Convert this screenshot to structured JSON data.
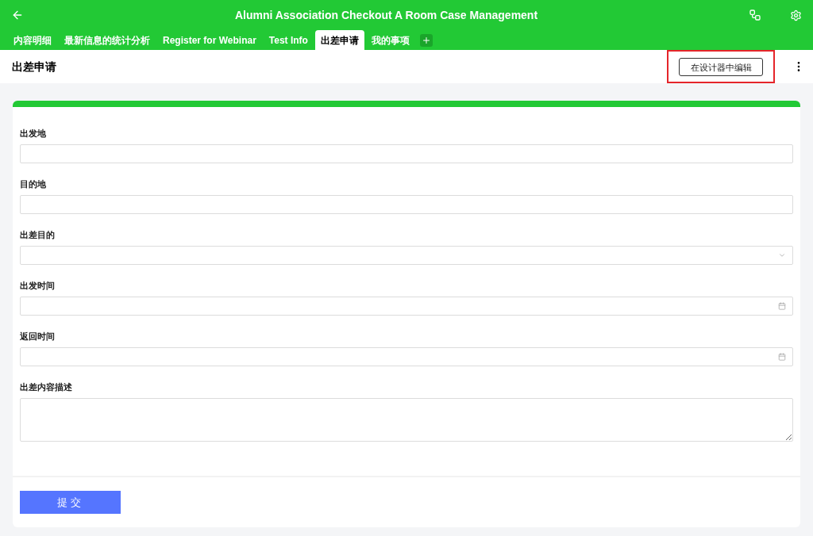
{
  "app_bar": {
    "title": "Alumni Association Checkout A Room Case Management"
  },
  "tabs": [
    {
      "label": "内容明细",
      "selected": false
    },
    {
      "label": "最新信息的统计分析",
      "selected": false
    },
    {
      "label": "Register for Webinar",
      "selected": false
    },
    {
      "label": "Test Info",
      "selected": false
    },
    {
      "label": "出差申请",
      "selected": true
    },
    {
      "label": "我的事项",
      "selected": false
    }
  ],
  "page_header": {
    "title": "出差申请",
    "edit_button": {
      "label": "在设计器中编辑",
      "highlighted": true
    }
  },
  "form": {
    "fields": [
      {
        "label": "出发地",
        "kind": "text"
      },
      {
        "label": "目的地",
        "kind": "text"
      },
      {
        "label": "出差目的",
        "kind": "select"
      },
      {
        "label": "出发时间",
        "kind": "date"
      },
      {
        "label": "返回时间",
        "kind": "date"
      },
      {
        "label": "出差内容描述",
        "kind": "textarea"
      }
    ],
    "submit_button": {
      "label": "提交"
    }
  }
}
